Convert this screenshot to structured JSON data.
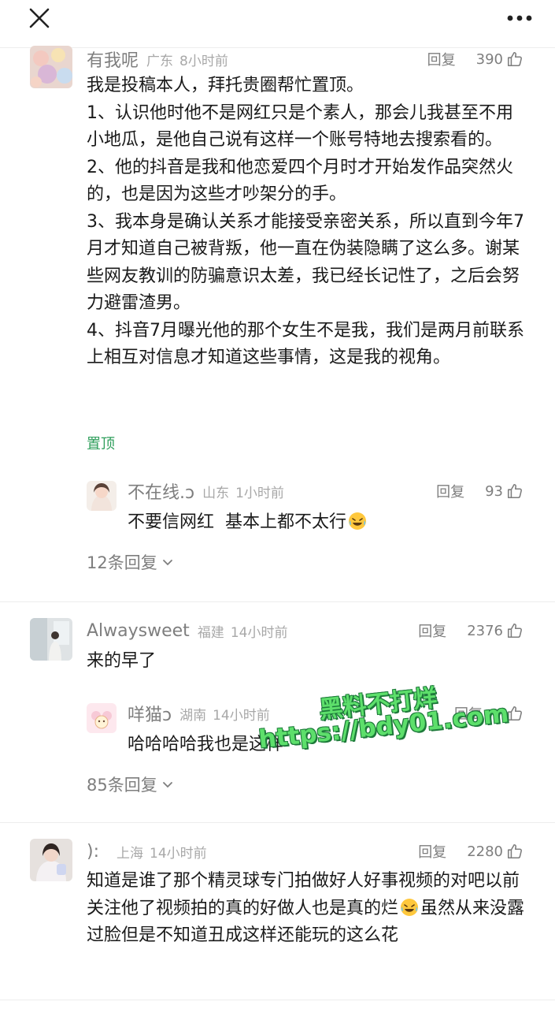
{
  "topbar": {
    "close_icon": "close-icon",
    "more_icon": "more-dots-icon"
  },
  "comments": [
    {
      "name": "有我呢",
      "location": "广东",
      "time": "8小时前",
      "reply_label": "回复",
      "likes": "390",
      "text": "我是投稿本人，拜托贵圈帮忙置顶。\n1、认识他时他不是网红只是个素人，那会儿我甚至不用小地瓜，是他自己说有这样一个账号特地去搜索看的。\n2、他的抖音是我和他恋爱四个月时才开始发作品突然火的，也是因为这些才吵架分的手。\n3、我本身是确认关系才能接受亲密关系，所以直到今年7月才知道自己被背叛，他一直在伪装隐瞒了这么多。谢某些网友教训的防骗意识太差，我已经长记性了，之后会努力避雷渣男。\n4、抖音7月曝光他的那个女生不是我，我们是两月前联系上相互对信息才知道这些事情，这是我的视角。",
      "pinned_label": "置顶",
      "reply": {
        "name": "不在线.ↄ",
        "location": "山东",
        "time": "1小时前",
        "reply_label": "回复",
        "likes": "93",
        "text": "不要信网红  基本上都不太行",
        "emoji": "laugh-cry-emoji"
      },
      "more_replies": "12条回复"
    },
    {
      "name": "Alwaysweet",
      "location": "福建",
      "time": "14小时前",
      "reply_label": "回复",
      "likes": "2376",
      "text": "来的早了",
      "reply": {
        "name": "咩猫ↄ",
        "location": "湖南",
        "time": "14小时前",
        "reply_label": "回复",
        "text": "哈哈哈哈我也是这样"
      },
      "more_replies": "85条回复"
    },
    {
      "name": "):",
      "location": "上海",
      "time": "14小时前",
      "reply_label": "回复",
      "likes": "2280",
      "text_part1": "知道是谁了那个精灵球专门拍做好人好事视频的对吧以前关注他了视频拍的真的好做人也是真的烂",
      "text_part2": "虽然从来没露过脸但是不知道丑成这样还能玩的这么花",
      "emoji": "laugh-cry-emoji"
    }
  ],
  "watermark": {
    "line1": "黑料不打烊",
    "line2": "https://bdy01.com"
  },
  "colors": {
    "pinned": "#2e9e5b",
    "meta": "#a8a8a8",
    "watermark": "#5ddf6b"
  }
}
